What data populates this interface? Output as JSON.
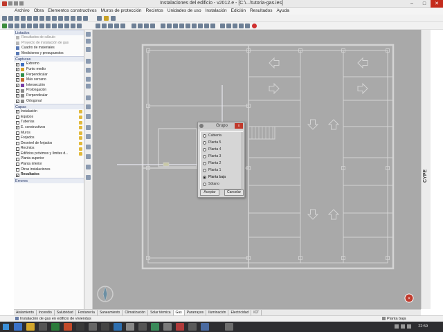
{
  "window": {
    "title": "Instalaciones del edificio - v2012.e - [C:\\...\\tutoria-gas.ies]"
  },
  "menu": [
    "Archivo",
    "Obra",
    "Elementos constructivos",
    "Muros de protección",
    "Recintos",
    "Unidades de uso",
    "Instalación",
    "Edición",
    "Resultados",
    "Ayuda"
  ],
  "panel": {
    "section_top": "Listados",
    "top_items": [
      {
        "label": "Resultados de cálculo",
        "dim": true
      },
      {
        "label": "Proyecto de instalación de gas",
        "dim": true
      },
      {
        "label": "Cuadro de materiales",
        "dim": false
      },
      {
        "label": "Mediciones y presupuestos",
        "dim": false
      }
    ],
    "section_captures": "Capturas",
    "captures": [
      "Extremo",
      "Punto medio",
      "Perpendicular",
      "Más cercano",
      "Intersección",
      "Prolongación",
      "Perpendicular",
      "Ortogonal"
    ],
    "section_layers": "Capas",
    "layers": [
      {
        "label": "Instalación",
        "checked": true,
        "bold": false
      },
      {
        "label": "Equipos",
        "checked": false,
        "bold": false
      },
      {
        "label": "Tuberías",
        "checked": false,
        "bold": false
      },
      {
        "label": "E. constructivos",
        "checked": true,
        "bold": false
      },
      {
        "label": "Muros",
        "checked": false,
        "bold": false
      },
      {
        "label": "Forjados",
        "checked": false,
        "bold": false
      },
      {
        "label": "Desnivel de forjados",
        "checked": false,
        "bold": false
      },
      {
        "label": "Recintos",
        "checked": false,
        "bold": false
      },
      {
        "label": "Edificios próximos y límites d...",
        "checked": false,
        "bold": false
      },
      {
        "label": "Planta superior",
        "checked": false,
        "bold": false
      },
      {
        "label": "Planta inferior",
        "checked": false,
        "bold": false
      },
      {
        "label": "Otras instalaciones",
        "checked": false,
        "bold": false
      },
      {
        "label": "Resultados",
        "checked": true,
        "bold": true
      }
    ],
    "section_errors": "Errores"
  },
  "dialog": {
    "title": "Grupo",
    "close_label": "x",
    "options": [
      "Cubierta",
      "Planta 5",
      "Planta 4",
      "Planta 3",
      "Planta 2",
      "Planta 1",
      "Planta baja",
      "Sótano"
    ],
    "selected_index": 6,
    "accept_label": "Aceptar",
    "cancel_label": "Cancelar"
  },
  "tabs": [
    "Aislamiento",
    "Incendio",
    "Salubridad",
    "Fontanería",
    "Saneamiento",
    "Climatización",
    "Solar térmica",
    "Gas",
    "Pararrayos",
    "Iluminación",
    "Electricidad",
    "ICT"
  ],
  "active_tab": 7,
  "brand_label": "CYPE",
  "status": {
    "text": "Instalación de gas en edificio de viviendas",
    "floor": "Planta baja"
  },
  "taskbar": {
    "clock": "22:59"
  },
  "colors": {
    "canvas_bg": "#a9a9a9",
    "plan_line": "#d4d4d4",
    "accent": "#c0392b"
  }
}
